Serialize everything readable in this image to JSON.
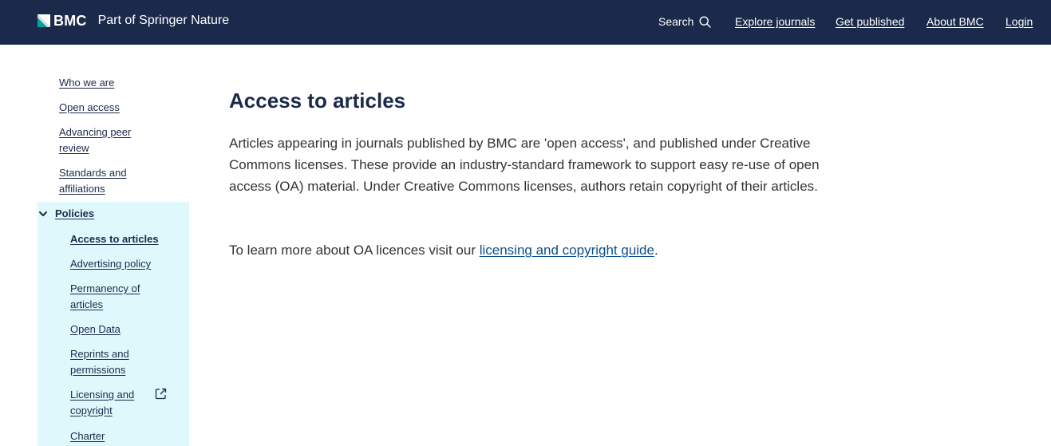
{
  "header": {
    "brand_name": "BMC",
    "brand_tagline": "Part of Springer Nature",
    "search_label": "Search",
    "nav": {
      "explore": "Explore journals",
      "publish": "Get published",
      "about": "About BMC",
      "login": "Login"
    }
  },
  "sidebar": {
    "items": [
      "Who we are",
      "Open access",
      "Advancing peer review",
      "Standards and affiliations"
    ],
    "section": {
      "label": "Policies",
      "items": [
        "Access to articles",
        "Advertising policy",
        "Permanency of articles",
        "Open Data",
        "Reprints and permissions",
        "Licensing and copyright",
        "Charter"
      ]
    }
  },
  "main": {
    "title": "Access to articles",
    "intro": "Articles appearing in journals published by BMC are 'open access', and published under Creative Commons licenses. These provide an industry-standard framework to support easy re-use of open access (OA) material. Under Creative Commons licenses, authors retain copyright of their articles.",
    "learn_prefix": "To learn more about OA licences visit our ",
    "learn_link": "licensing and copyright guide",
    "learn_suffix": "."
  },
  "colors": {
    "header_bg": "#1b2a4a",
    "sidebar_active_bg": "#dff8fc",
    "heading": "#1b2a4a",
    "link": "#0b4e8c",
    "logo_accent": "#00a69c"
  },
  "icons": {
    "logo": "bmc-logo-icon",
    "search": "search-icon",
    "chevron": "chevron-down-icon",
    "external": "external-link-icon"
  }
}
